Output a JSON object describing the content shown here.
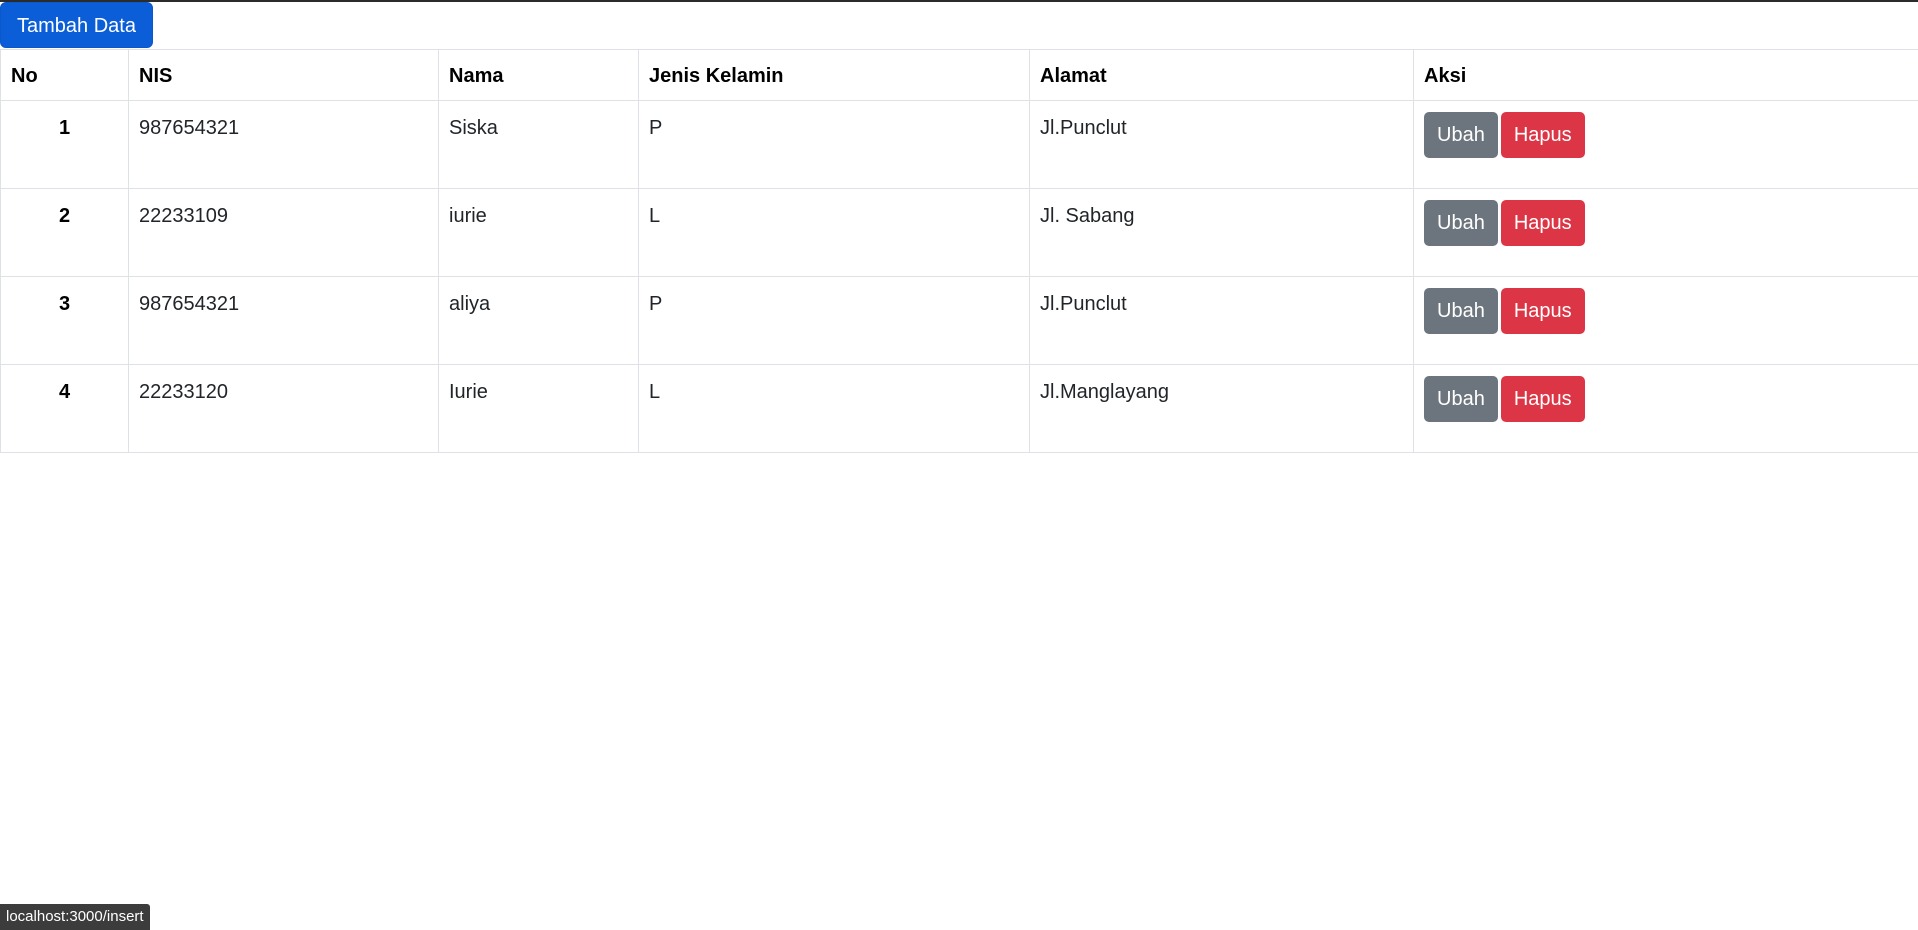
{
  "toolbar": {
    "add_label": "Tambah Data"
  },
  "table": {
    "headers": {
      "no": "No",
      "nis": "NIS",
      "nama": "Nama",
      "jenis_kelamin": "Jenis Kelamin",
      "alamat": "Alamat",
      "aksi": "Aksi"
    },
    "rows": [
      {
        "no": "1",
        "nis": "987654321",
        "nama": "Siska",
        "jenis_kelamin": "P",
        "alamat": "Jl.Punclut",
        "edit_label": "Ubah",
        "delete_label": "Hapus"
      },
      {
        "no": "2",
        "nis": "22233109",
        "nama": "iurie",
        "jenis_kelamin": "L",
        "alamat": "Jl. Sabang",
        "edit_label": "Ubah",
        "delete_label": "Hapus"
      },
      {
        "no": "3",
        "nis": "987654321",
        "nama": "aliya",
        "jenis_kelamin": "P",
        "alamat": "Jl.Punclut",
        "edit_label": "Ubah",
        "delete_label": "Hapus"
      },
      {
        "no": "4",
        "nis": "22233120",
        "nama": "Iurie",
        "jenis_kelamin": "L",
        "alamat": "Jl.Manglayang",
        "edit_label": "Ubah",
        "delete_label": "Hapus"
      }
    ]
  },
  "status_bar": {
    "url": "localhost:3000/insert"
  },
  "colors": {
    "primary": "#0b5ed7",
    "secondary": "#6c757d",
    "danger": "#dc3545"
  }
}
